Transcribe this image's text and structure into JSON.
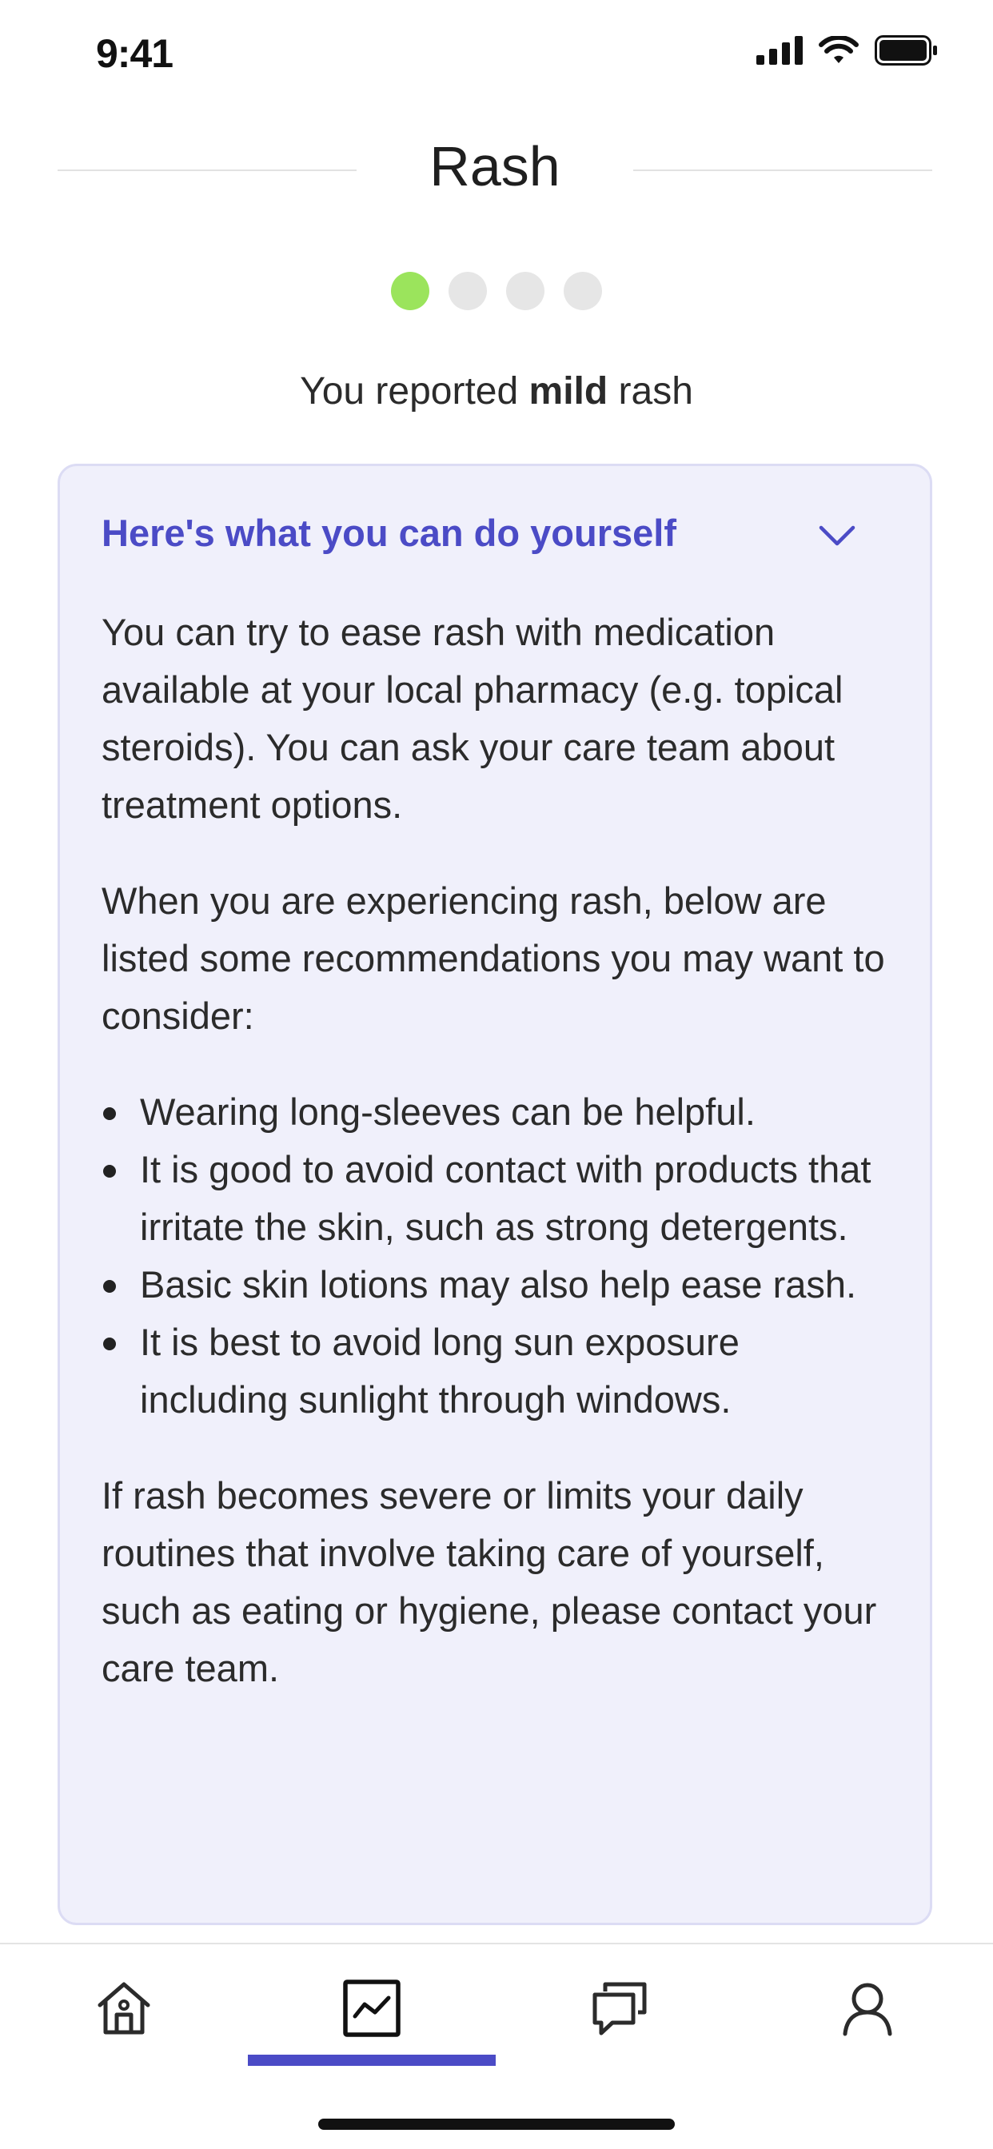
{
  "status_bar": {
    "time": "9:41"
  },
  "header": {
    "title": "Rash"
  },
  "stepper": {
    "total_steps": 4,
    "current_step": 1,
    "active_color": "#9be45c"
  },
  "summary": {
    "prefix": "You reported ",
    "severity": "mild",
    "suffix": " rash"
  },
  "advice_card": {
    "title": "Here's what you can do yourself",
    "paragraph_1": "You can try to ease rash with medication available at your local pharmacy (e.g. topical steroids). You can ask your care team about treatment options.",
    "paragraph_2": "When you are experiencing rash, below are listed some recommendations you may want to consider:",
    "bullets": [
      "Wearing long-sleeves can be helpful.",
      "It is good to avoid contact with products that irritate the skin, such as strong detergents.",
      "Basic skin lotions may also help ease rash.",
      "It is best to avoid long sun exposure including sunlight through windows."
    ],
    "paragraph_3": "If rash becomes severe or limits your daily routines that involve taking care of yourself, such as eating or hygiene, please contact your care team."
  },
  "tab_bar": {
    "tabs": [
      {
        "icon": "home-icon",
        "selected": false
      },
      {
        "icon": "chart-icon",
        "selected": true
      },
      {
        "icon": "chat-icon",
        "selected": false
      },
      {
        "icon": "profile-icon",
        "selected": false
      }
    ],
    "accent_color": "#4b4bc6"
  }
}
